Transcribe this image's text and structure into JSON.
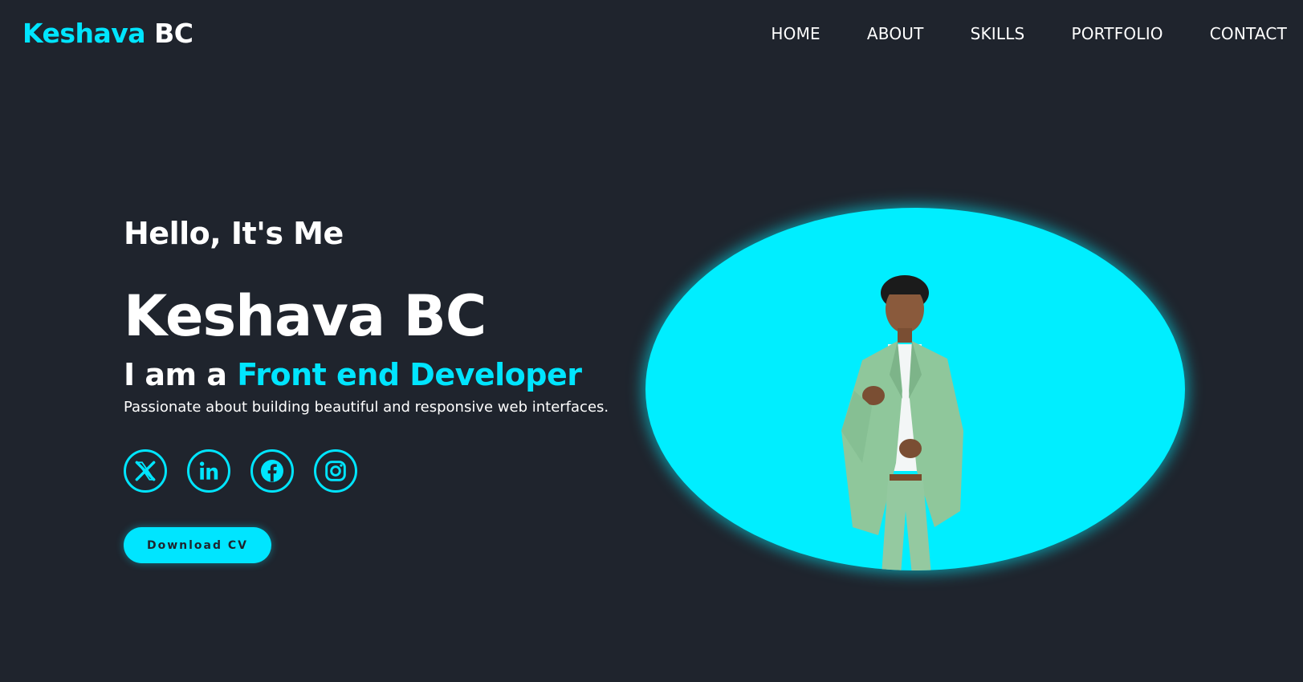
{
  "header": {
    "logo_first": "Keshava",
    "logo_second": "BC",
    "nav": [
      "HOME",
      "ABOUT",
      "SKILLS",
      "PORTFOLIO",
      "CONTACT"
    ]
  },
  "hero": {
    "greeting": "Hello, It's Me",
    "name": "Keshava BC",
    "role_prefix": "I am a",
    "role_highlight": "Front end Developer",
    "tagline": "Passionate about building beautiful and responsive web interfaces.",
    "socials": [
      "x-icon",
      "linkedin-icon",
      "facebook-icon",
      "instagram-icon"
    ],
    "cv_button": "Download CV"
  },
  "colors": {
    "background": "#1f242d",
    "accent": "#00e5ff",
    "text": "#ffffff"
  }
}
